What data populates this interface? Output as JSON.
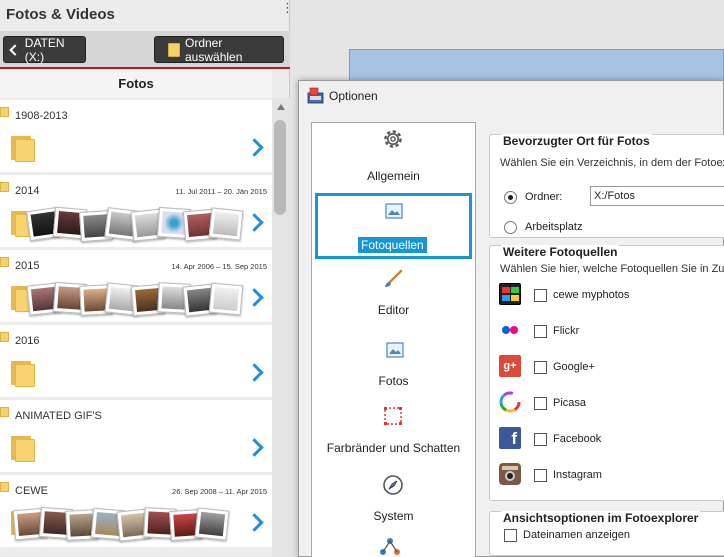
{
  "app": {
    "title": "Fotos & Videos",
    "back_label": "DATEN (X:)",
    "choose_folder_label": "Ordner auswählen",
    "section_title": "Fotos"
  },
  "folders": [
    {
      "name": "1908-2013",
      "date": ""
    },
    {
      "name": "2014",
      "date": "11. Jul 2011 – 20. Jän 2015"
    },
    {
      "name": "2015",
      "date": "14. Apr 2006 – 15. Sep 2015"
    },
    {
      "name": "2016",
      "date": ""
    },
    {
      "name": "ANIMATED GIF'S",
      "date": ""
    },
    {
      "name": "CEWE",
      "date": "26. Sep 2008 – 11. Apr 2015"
    }
  ],
  "dialog": {
    "title": "Optionen",
    "categories": [
      {
        "label": "Allgemein",
        "icon": "gear-icon"
      },
      {
        "label": "Fotoquellen",
        "icon": "image-icon"
      },
      {
        "label": "Editor",
        "icon": "brush-icon"
      },
      {
        "label": "Fotos",
        "icon": "image-icon"
      },
      {
        "label": "Farbränder und Schatten",
        "icon": "frame-icon"
      },
      {
        "label": "System",
        "icon": "compass-icon"
      }
    ],
    "preferred": {
      "title": "Bevorzugter Ort für Fotos",
      "desc": "Wählen Sie ein Verzeichnis, in dem der Fotoexpl",
      "folder_label": "Ordner:",
      "folder_value": "X:/Fotos",
      "workspace_label": "Arbeitsplatz"
    },
    "sources": {
      "title": "Weitere Fotoquellen",
      "desc": "Wählen Sie hier, welche Fotoquellen Sie in Zuku",
      "items": [
        {
          "label": "cewe myphotos",
          "icon": "cewe-icon"
        },
        {
          "label": "Flickr",
          "icon": "flickr-icon"
        },
        {
          "label": "Google+",
          "icon": "google-plus-icon"
        },
        {
          "label": "Picasa",
          "icon": "picasa-icon"
        },
        {
          "label": "Facebook",
          "icon": "facebook-icon"
        },
        {
          "label": "Instagram",
          "icon": "instagram-icon"
        }
      ]
    },
    "view": {
      "title": "Ansichtsoptionen im Fotoexplorer",
      "filenames_label": "Dateinamen anzeigen"
    }
  },
  "colors": {
    "accent": "#1796d6",
    "chevron": "#1e8fd8",
    "red_line": "#b31b1b",
    "header_btn": "#3b3b3b"
  }
}
